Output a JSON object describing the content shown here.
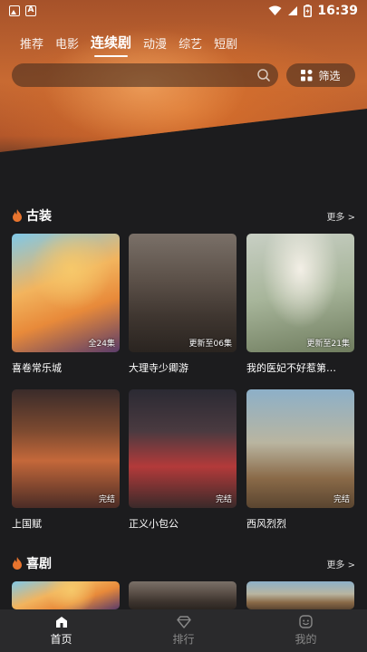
{
  "status_bar": {
    "time": "16:39"
  },
  "tabs": [
    {
      "label": "推荐"
    },
    {
      "label": "电影"
    },
    {
      "label": "连续剧"
    },
    {
      "label": "动漫"
    },
    {
      "label": "综艺"
    },
    {
      "label": "短剧"
    }
  ],
  "active_tab_index": 2,
  "search": {
    "placeholder": ""
  },
  "filter": {
    "label": "筛选"
  },
  "sections": [
    {
      "title": "古装",
      "more": "更多 >",
      "items": [
        {
          "title": "喜卷常乐城",
          "badge": "全24集"
        },
        {
          "title": "大理寺少卿游",
          "badge": "更新至06集"
        },
        {
          "title": "我的医妃不好惹第…",
          "badge": "更新至21集"
        },
        {
          "title": "上国赋",
          "badge": "完结"
        },
        {
          "title": "正义小包公",
          "badge": "完结"
        },
        {
          "title": "西风烈烈",
          "badge": "完结"
        }
      ]
    },
    {
      "title": "喜剧",
      "more": "更多 >"
    }
  ],
  "bottom_nav": [
    {
      "label": "首页",
      "icon": "home-icon"
    },
    {
      "label": "排行",
      "icon": "diamond-icon"
    },
    {
      "label": "我的",
      "icon": "profile-icon"
    }
  ],
  "colors": {
    "accent": "#e8742e",
    "background": "#1c1c1e",
    "nav_bg": "#2a2a2c"
  }
}
